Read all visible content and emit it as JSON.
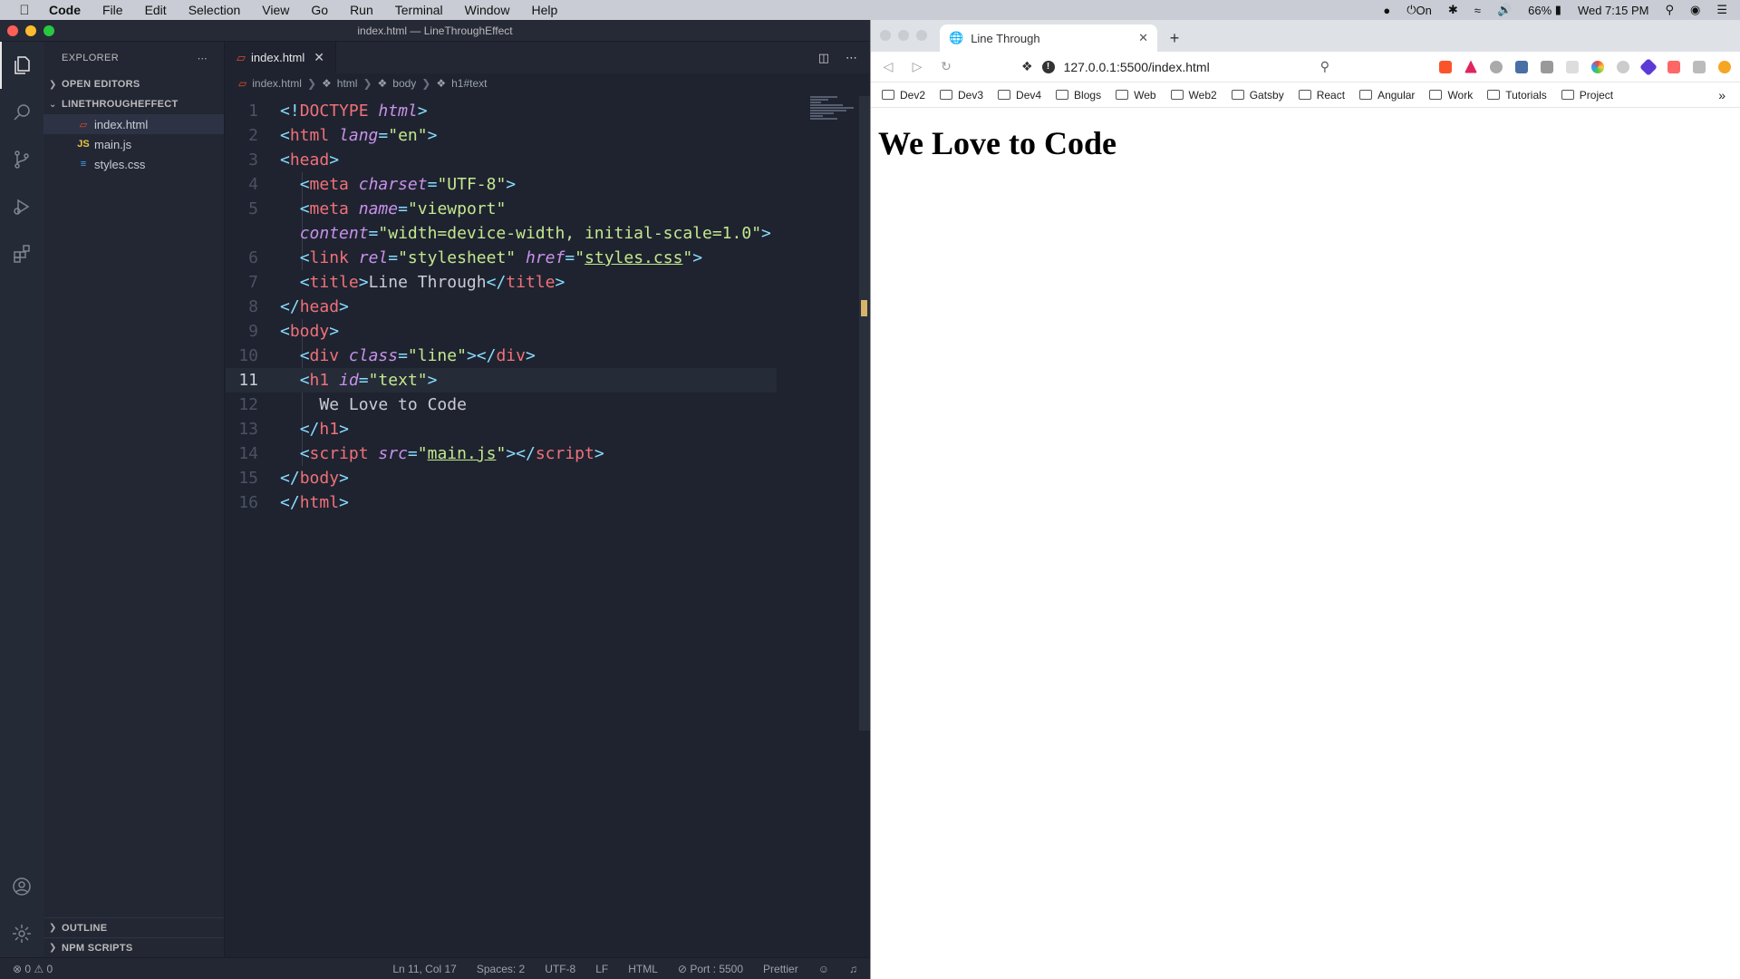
{
  "menubar": {
    "app": "Code",
    "items": [
      "File",
      "Edit",
      "Selection",
      "View",
      "Go",
      "Run",
      "Terminal",
      "Window",
      "Help"
    ],
    "status_on": "On",
    "battery": "66%",
    "clock": "Wed 7:15 PM"
  },
  "vscode": {
    "window_title": "index.html — LineThroughEffect",
    "explorer_title": "EXPLORER",
    "open_editors": "OPEN EDITORS",
    "project": "LINETHROUGHEFFECT",
    "files": [
      "index.html",
      "main.js",
      "styles.css"
    ],
    "outline": "OUTLINE",
    "npm_scripts": "NPM SCRIPTS",
    "tab_label": "index.html",
    "breadcrumb": [
      "index.html",
      "html",
      "body",
      "h1#text"
    ],
    "status": {
      "errors": "⊗ 0 ⚠ 0",
      "position": "Ln 11, Col 17",
      "spaces": "Spaces: 2",
      "encoding": "UTF-8",
      "eol": "LF",
      "language": "HTML",
      "port": "Port : 5500",
      "formatter": "Prettier"
    }
  },
  "browser": {
    "tab_title": "Line Through",
    "url": "127.0.0.1:5500/index.html",
    "bookmarks": [
      "Dev2",
      "Dev3",
      "Dev4",
      "Blogs",
      "Web",
      "Web2",
      "Gatsby",
      "React",
      "Angular",
      "Work",
      "Tutorials",
      "Project"
    ],
    "heading": "We Love to Code"
  }
}
